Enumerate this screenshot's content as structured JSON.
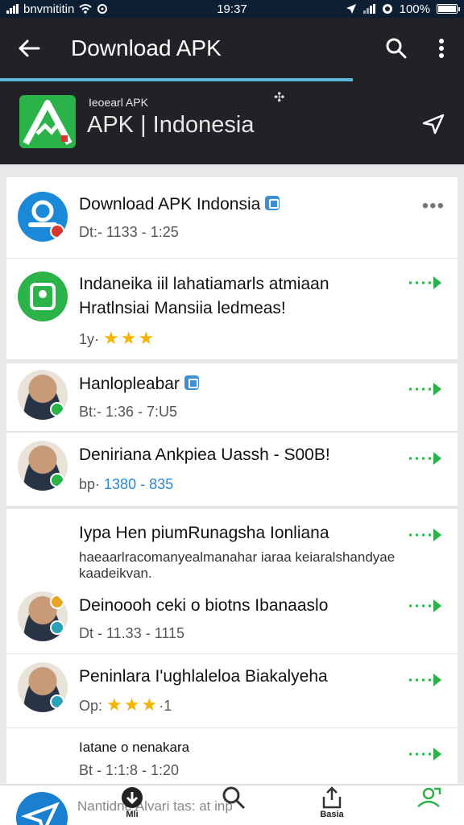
{
  "status_bar": {
    "carrier": "bnvmititin",
    "time": "19:37",
    "battery": "100%"
  },
  "appbar": {
    "title": "Download APK"
  },
  "header": {
    "small_text": "Ieoearl APK",
    "big_text": "APK | Indonesia"
  },
  "items": [
    {
      "title": "Download APK Indonsia",
      "subtitle": "Dt:- 1133 - 1:25"
    },
    {
      "title": "Indaneika iil lahatiamarls atmiaan",
      "title2": "Hratlnsiai Mansiia ledmeas!",
      "rating_prefix": "1y·",
      "stars": "★★★"
    },
    {
      "title": "Hanlopleabar",
      "subtitle": "Bt:- 1:36 - 7:U5"
    },
    {
      "title": "Deniriana Ankpiea Uassh - S00B!",
      "subtitle_prefix": "bp·",
      "subtitle_value": "1380 - 835"
    },
    {
      "title": "Iypa Hen piumRunagsha Ionliana",
      "description": "haeaarlracomanyealmanahar iaraa keiaralshandyae kaadeikvan."
    },
    {
      "title": "Deinoooh ceki o biotns Ibanaaslo",
      "subtitle": "Dt - 11.33 - 1115"
    },
    {
      "title": "Peninlara I'ughlaleloa Biakalyeha",
      "rating_prefix": "Op:",
      "stars": "★★★",
      "rating_suffix": "·1"
    },
    {
      "title": "Iatane o nenakara",
      "subtitle": "Bt - 1:1:8 - 1:20"
    }
  ],
  "bottom_nav": {
    "background_text": "Nantidne Alvari tas: at inp",
    "items": [
      "Mli",
      "",
      "Basia",
      ""
    ]
  },
  "colors": {
    "appbar": "#202226",
    "accent_green": "#2bb34a",
    "progress": "#5bb7dc",
    "star": "#f4b400"
  }
}
